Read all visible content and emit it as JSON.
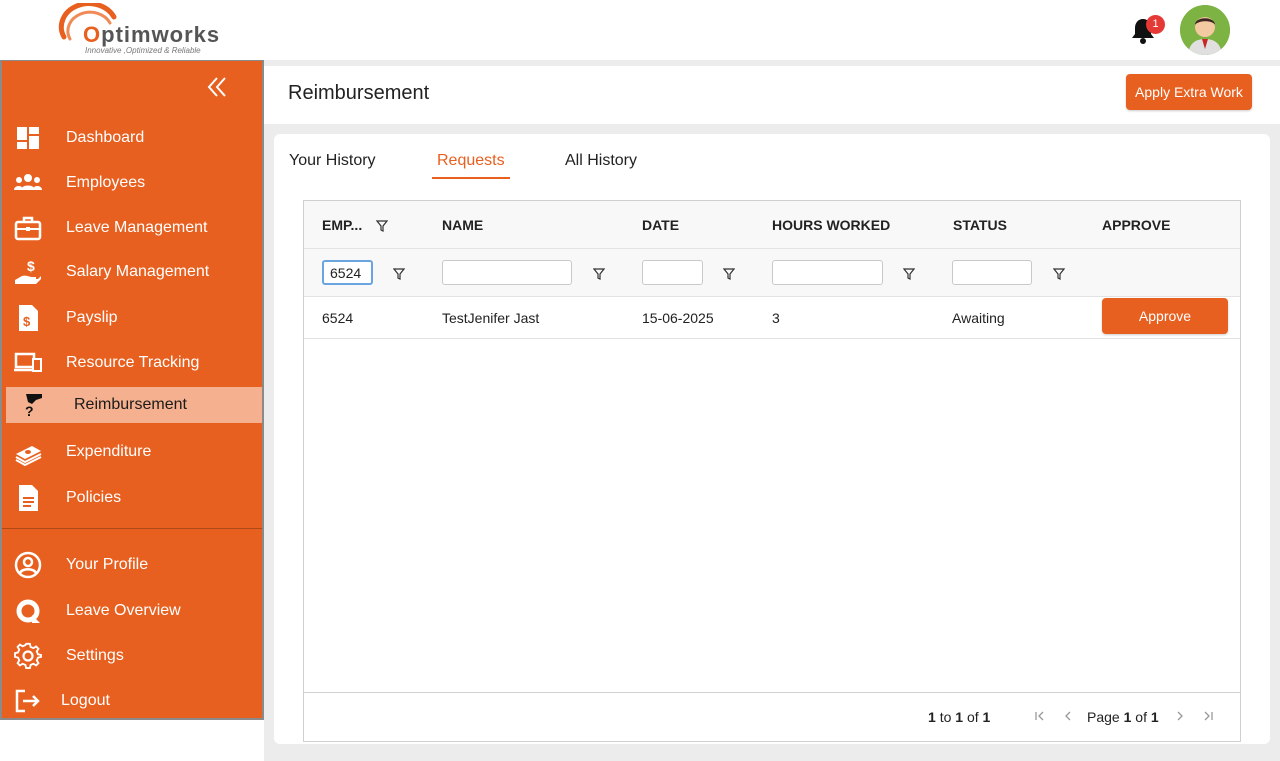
{
  "logo": {
    "name_prefix": "O",
    "name_rest": "ptimworks",
    "tagline": "Innovative ,Optimized & Reliable"
  },
  "notifications": {
    "count": "1"
  },
  "sidebar": {
    "items": [
      {
        "label": "Dashboard",
        "icon": "dashboard-icon"
      },
      {
        "label": "Employees",
        "icon": "employees-icon"
      },
      {
        "label": "Leave Management",
        "icon": "briefcase-icon"
      },
      {
        "label": "Salary Management",
        "icon": "salary-hand-icon"
      },
      {
        "label": "Payslip",
        "icon": "payslip-icon"
      },
      {
        "label": "Resource Tracking",
        "icon": "devices-icon"
      },
      {
        "label": "Reimbursement",
        "icon": "reimbursement-icon",
        "active": true
      },
      {
        "label": "Expenditure",
        "icon": "money-stack-icon"
      },
      {
        "label": "Policies",
        "icon": "document-icon"
      },
      {
        "label": "Your Profile",
        "icon": "profile-icon"
      },
      {
        "label": "Leave Overview",
        "icon": "leave-overview-icon"
      },
      {
        "label": "Settings",
        "icon": "gear-icon"
      },
      {
        "label": "Logout",
        "icon": "logout-icon"
      }
    ]
  },
  "header": {
    "title": "Reimbursement",
    "apply_button": "Apply Extra Work"
  },
  "tabs": [
    {
      "label": "Your History"
    },
    {
      "label": "Requests",
      "active": true
    },
    {
      "label": "All History"
    }
  ],
  "grid": {
    "columns": [
      "EMP...",
      "NAME",
      "DATE",
      "HOURS WORKED",
      "STATUS",
      "APPROVE"
    ],
    "filters": {
      "emp": "6524",
      "name": "",
      "date": "",
      "hours": "",
      "status": ""
    },
    "rows": [
      {
        "emp": "6524",
        "name": "TestJenifer Jast",
        "date": "15-06-2025",
        "hours": "3",
        "status": "Awaiting",
        "action": "Approve"
      }
    ],
    "footer": {
      "range_from": "1",
      "range_to_word": "to",
      "range_to": "1",
      "range_of_word": "of",
      "range_total": "1",
      "page_word": "Page",
      "page_current": "1",
      "page_of_word": "of",
      "page_total": "1"
    }
  },
  "colors": {
    "accent": "#e8601f",
    "active_item": "#f5b08f",
    "badge": "#e53935"
  }
}
